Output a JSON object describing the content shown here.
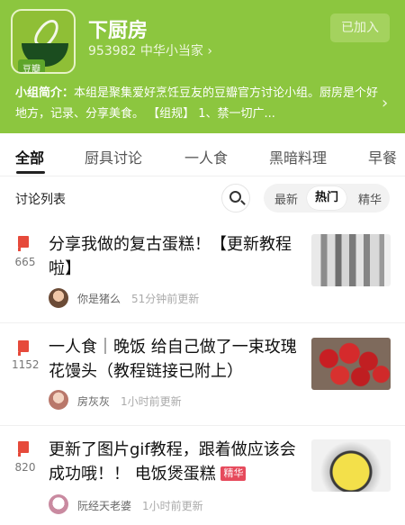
{
  "header": {
    "group_name": "下厨房",
    "members_line": "953982 中华小当家 ›",
    "logo_tag": "豆瓣",
    "joined_label": "已加入",
    "intro_label": "小组简介：",
    "intro_text": "本组是聚集爱好烹饪豆友的豆瓣官方讨论小组。厨房是个好地方，记录、分享美食。 【组规】 1、禁一切广...",
    "chevron": "›",
    "colors": {
      "brand_green": "#8cc63f"
    }
  },
  "tabs": [
    {
      "label": "全部",
      "active": true
    },
    {
      "label": "厨具讨论"
    },
    {
      "label": "一人食"
    },
    {
      "label": "黑暗料理"
    },
    {
      "label": "早餐"
    }
  ],
  "discussion": {
    "title": "讨论列表",
    "search_icon": "search-icon",
    "sort_options": [
      {
        "label": "最新"
      },
      {
        "label": "热门",
        "active": true
      },
      {
        "label": "精华"
      }
    ]
  },
  "posts": [
    {
      "count": "665",
      "title": "分享我做的复古蛋糕！【更新教程啦】",
      "badge": "",
      "author": "你是猪么",
      "time": "51分钟前更新",
      "thumb": "piping-tips-photo"
    },
    {
      "count": "1152",
      "title": "一人食｜晚饭 给自己做了一束玫瑰花馒头（教程链接已附上）",
      "badge": "",
      "author": "房灰灰",
      "time": "1小时前更新",
      "thumb": "rose-buns-photo"
    },
    {
      "count": "820",
      "title": "更新了图片gif教程，跟着做应该会成功哦！！ 电饭煲蛋糕",
      "badge": "精华",
      "author": "阮经天老婆",
      "time": "1小时前更新",
      "thumb": "cake-pan-photo"
    }
  ]
}
